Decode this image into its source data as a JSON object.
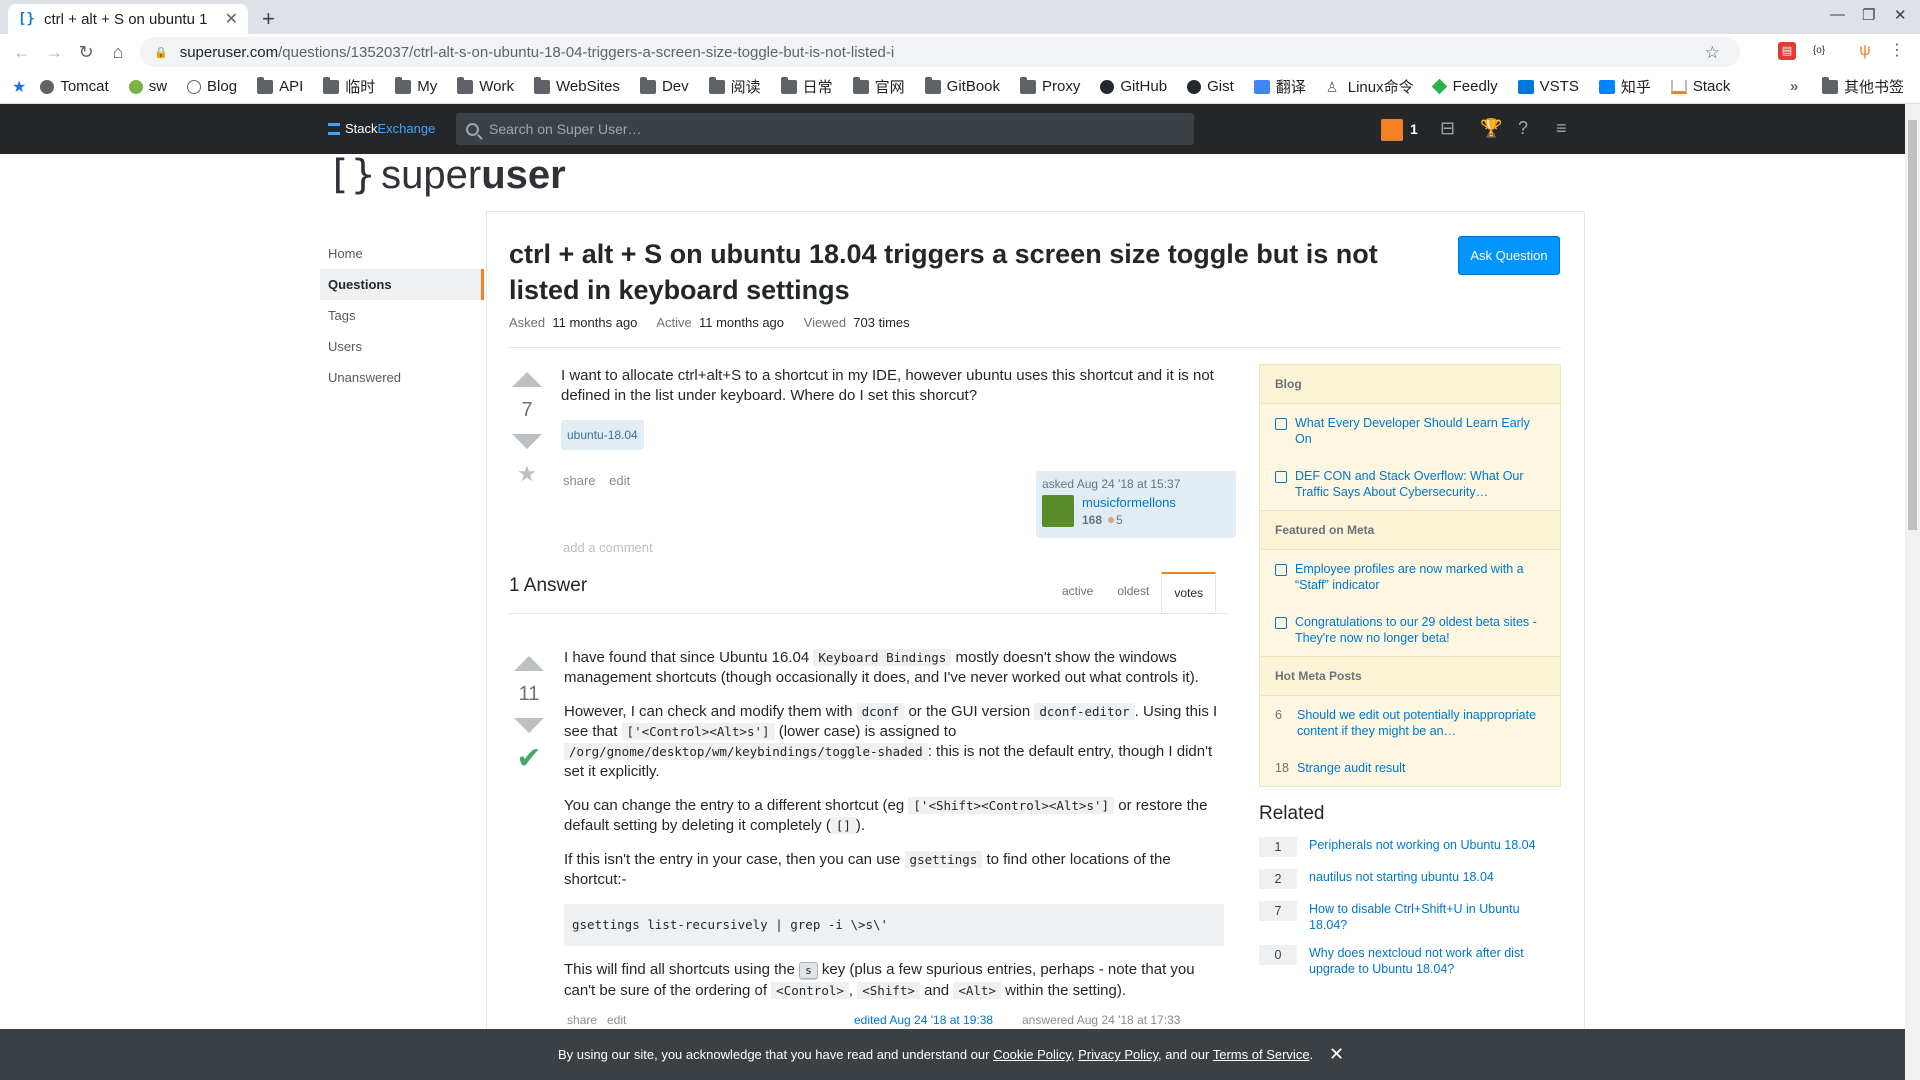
{
  "browser": {
    "tab_title": "ctrl + alt + S on ubuntu 1",
    "url_host": "superuser.com",
    "url_path": "/questions/1352037/ctrl-alt-s-on-ubuntu-18-04-triggers-a-screen-size-toggle-but-is-not-listed-i",
    "bookmarks": [
      "Tomcat",
      "sw",
      "Blog",
      "API",
      "临时",
      "My",
      "Work",
      "WebSites",
      "Dev",
      "阅读",
      "日常",
      "官网",
      "GitBook",
      "Proxy",
      "GitHub",
      "Gist",
      "翻译",
      "Linux命令",
      "Feedly",
      "VSTS",
      "知乎",
      "Stack"
    ],
    "other_bookmarks": "其他书签",
    "overflow": "»"
  },
  "topbar": {
    "brand_a": "Stack",
    "brand_b": "Exchange",
    "search_placeholder": "Search on Super User…",
    "rep": "1"
  },
  "site": {
    "logo_a": "super",
    "logo_b": "user"
  },
  "nav": [
    "Home",
    "Questions",
    "Tags",
    "Users",
    "Unanswered"
  ],
  "question": {
    "title": "ctrl + alt + S on ubuntu 18.04 triggers a screen size toggle but is not listed in keyboard settings",
    "ask_button": "Ask Question",
    "asked_label": "Asked",
    "asked_value": "11 months ago",
    "active_label": "Active",
    "active_value": "11 months ago",
    "viewed_label": "Viewed",
    "viewed_value": "703 times",
    "votes": "7",
    "body": "I want to allocate ctrl+alt+S to a shortcut in my IDE, however ubuntu uses this shortcut and it is not defined in the list under keyboard. Where do I set this shorcut?",
    "tag": "ubuntu-18.04",
    "share": "share",
    "edit": "edit",
    "asked_when": "asked Aug 24 '18 at 15:37",
    "user": "musicformellons",
    "user_rep": "168",
    "user_bronze": "5",
    "add_comment": "add a comment"
  },
  "answers": {
    "count_label": "1 Answer",
    "tabs": [
      "active",
      "oldest",
      "votes"
    ],
    "votes": "11",
    "footer_share": "share",
    "footer_edit": "edit",
    "footer_edited": "edited Aug 24 '18 at 19:38",
    "footer_answered": "answered Aug 24 '18 at 17:33",
    "p1_a": "I have found that since Ubuntu 16.04 ",
    "p1_code": "Keyboard Bindings",
    "p1_b": " mostly doesn't show the windows management shortcuts (though occasionally it does, and I've never worked out what controls it).",
    "p2_a": "However, I can check and modify them with ",
    "p2_code1": "dconf",
    "p2_b": " or the GUI version ",
    "p2_code2": "dconf-editor",
    "p2_c": ". Using this I see that ",
    "p2_code3": "['<Control><Alt>s']",
    "p2_d": " (lower case) is assigned to ",
    "p2_code4": "/org/gnome/desktop/wm/keybindings/toggle-shaded",
    "p2_e": ": this is not the default entry, though I didn't set it explicitly.",
    "p3_a": "You can change the entry to a different shortcut (eg ",
    "p3_code1": "['<Shift><Control><Alt>s']",
    "p3_b": " or restore the default setting by deleting it completely (",
    "p3_code2": "[]",
    "p3_c": ").",
    "p4_a": "If this isn't the entry in your case, then you can use ",
    "p4_code": "gsettings",
    "p4_b": " to find other locations of the shortcut:-",
    "pre": "gsettings list-recursively | grep -i \\>s\\'",
    "p5_a": "This will find all shortcuts using the ",
    "p5_kbd": "s",
    "p5_b": " key (plus a few spurious entries, perhaps - note that you can't be sure of the ordering of ",
    "p5_code1": "<Control>",
    "p5_c": ", ",
    "p5_code2": "<Shift>",
    "p5_d": " and ",
    "p5_code3": "<Alt>",
    "p5_e": " within the setting)."
  },
  "sidebar": {
    "blog_header": "Blog",
    "blog": [
      "What Every Developer Should Learn Early On",
      "DEF CON and Stack Overflow: What Our Traffic Says About Cybersecurity…"
    ],
    "meta_header": "Featured on Meta",
    "meta": [
      "Employee profiles are now marked with a “Staff” indicator",
      "Congratulations to our 29 oldest beta sites - They're now no longer beta!"
    ],
    "hot_header": "Hot Meta Posts",
    "hot": [
      {
        "count": "6",
        "title": "Should we edit out potentially inappropriate content if they might be an…"
      },
      {
        "count": "18",
        "title": "Strange audit result"
      }
    ],
    "related_header": "Related",
    "related": [
      {
        "count": "1",
        "title": "Peripherals not working on Ubuntu 18.04"
      },
      {
        "count": "2",
        "title": "nautilus not starting ubuntu 18.04"
      },
      {
        "count": "7",
        "title": "How to disable Ctrl+Shift+U in Ubuntu 18.04?"
      },
      {
        "count": "0",
        "title": "Why does nextcloud not work after dist upgrade to Ubuntu 18.04?"
      }
    ]
  },
  "cookie": {
    "text_a": "By using our site, you acknowledge that you have read and understand our ",
    "cookie_policy": "Cookie Policy",
    "sep1": ", ",
    "privacy_policy": "Privacy Policy",
    "text_b": ", and our ",
    "terms": "Terms of Service",
    "text_c": "."
  }
}
